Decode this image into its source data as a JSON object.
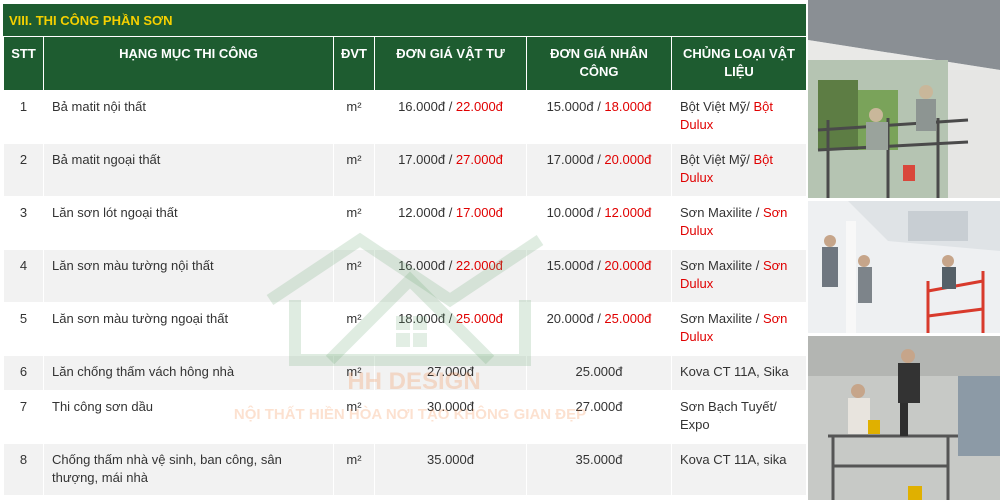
{
  "section_title": "VIII. THI CÔNG PHẦN SƠN",
  "table": {
    "headers": {
      "stt": "STT",
      "item": "HẠNG MỤC THI CÔNG",
      "unit": "ĐVT",
      "material_price": "ĐƠN GIÁ VẬT TƯ",
      "labor_price": "ĐƠN GIÁ NHÂN CÔNG",
      "material_type": "CHỦNG LOẠI VẬT LIỆU"
    },
    "rows": [
      {
        "stt": "1",
        "item": "Bả matit nội thất",
        "unit": "m²",
        "material": "16.000đ",
        "material_sep": " / ",
        "material_alt": "22.000đ",
        "labor": "15.000đ",
        "labor_sep": " / ",
        "labor_alt": "18.000đ",
        "brand": "Bột Việt Mỹ/ ",
        "brand_alt": "Bột Dulux"
      },
      {
        "stt": "2",
        "item": "Bả matit ngoại thất",
        "unit": "m²",
        "material": "17.000đ",
        "material_sep": " / ",
        "material_alt": "27.000đ",
        "labor": "17.000đ",
        "labor_sep": " / ",
        "labor_alt": "20.000đ",
        "brand": "Bột Việt Mỹ/ ",
        "brand_alt": "Bột Dulux"
      },
      {
        "stt": "3",
        "item": "Lăn sơn lót ngoại thất",
        "unit": "m²",
        "material": "12.000đ",
        "material_sep": " / ",
        "material_alt": "17.000đ",
        "labor": "10.000đ",
        "labor_sep": " / ",
        "labor_alt": "12.000đ",
        "brand": "Sơn Maxilite / ",
        "brand_alt": "Sơn Dulux"
      },
      {
        "stt": "4",
        "item": "Lăn sơn màu tường nội thất",
        "unit": "m²",
        "material": "16.000đ",
        "material_sep": " / ",
        "material_alt": "22.000đ",
        "labor": "15.000đ",
        "labor_sep": " / ",
        "labor_alt": "20.000đ",
        "brand": "Sơn Maxilite / ",
        "brand_alt": "Sơn Dulux"
      },
      {
        "stt": "5",
        "item": "Lăn sơn màu tường ngoại thất",
        "unit": "m²",
        "material": "18.000đ",
        "material_sep": " / ",
        "material_alt": "25.000đ",
        "labor": "20.000đ",
        "labor_sep": " / ",
        "labor_alt": "25.000đ",
        "brand": "Sơn Maxilite / ",
        "brand_alt": "Sơn Dulux"
      },
      {
        "stt": "6",
        "item": "Lăn chống thấm vách hông nhà",
        "unit": "m²",
        "material": "27.000đ",
        "labor": "25.000đ",
        "brand": "Kova CT 11A, Sika"
      },
      {
        "stt": "7",
        "item": "Thi công sơn dầu",
        "unit": "m²",
        "material": "30.000đ",
        "labor": "27.000đ",
        "brand": "Sơn Bạch Tuyết/ Expo"
      },
      {
        "stt": "8",
        "item": "Chống thấm nhà vệ sinh, ban công, sân thượng, mái nhà",
        "unit": "m²",
        "material": "35.000đ",
        "labor": "35.000đ",
        "brand": "Kova CT 11A, sika"
      }
    ]
  },
  "watermark": {
    "name": "HH DESIGN",
    "slogan": "NỘI THẤT HIỀN HÒA NƠI TẠO KHÔNG GIAN ĐẸP"
  },
  "colors": {
    "header_green": "#1e5c30",
    "title_yellow": "#f5d000",
    "alt_price_red": "#e00000"
  }
}
